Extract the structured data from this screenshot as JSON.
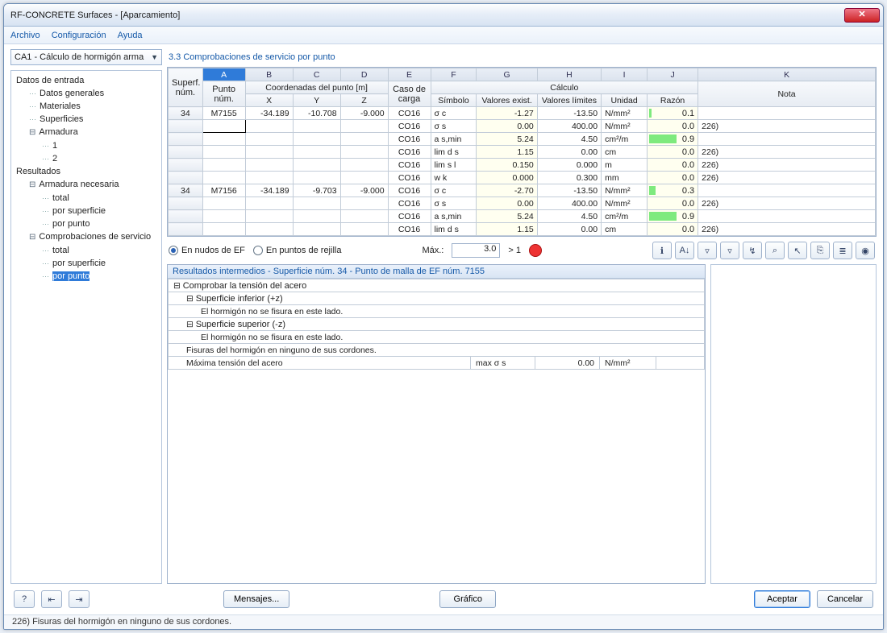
{
  "window": {
    "title": "RF-CONCRETE Surfaces - [Aparcamiento]"
  },
  "menu": {
    "file": "Archivo",
    "config": "Configuración",
    "help": "Ayuda"
  },
  "combo": {
    "value": "CA1 - Cálculo de hormigón arma"
  },
  "tree": {
    "entrada": "Datos de entrada",
    "generales": "Datos generales",
    "materiales": "Materiales",
    "superficies": "Superficies",
    "armadura": "Armadura",
    "a1": "1",
    "a2": "2",
    "resultados": "Resultados",
    "arm_nec": "Armadura necesaria",
    "total": "total",
    "por_superficie": "por superficie",
    "por_punto": "por punto",
    "comprobaciones": "Comprobaciones de servicio",
    "total2": "total",
    "por_superficie2": "por superficie",
    "por_punto2": "por punto"
  },
  "panel": {
    "title": "3.3 Comprobaciones de servicio por punto"
  },
  "headers": {
    "letters": [
      "A",
      "B",
      "C",
      "D",
      "E",
      "F",
      "G",
      "H",
      "I",
      "J",
      "K"
    ],
    "superf": "Superf.\nnúm.",
    "punto": "Punto\nnúm.",
    "coord": "Coordenadas del punto [m]",
    "x": "X",
    "y": "Y",
    "z": "Z",
    "caso": "Caso de\ncarga",
    "calc": "Cálculo",
    "simbolo": "Símbolo",
    "exist": "Valores exist.",
    "lim": "Valores límites",
    "unidad": "Unidad",
    "razon": "Razón",
    "nota": "Nota"
  },
  "rows": [
    {
      "surf": "34",
      "pt": "M7155",
      "x": "-34.189",
      "y": "-10.708",
      "z": "-9.000",
      "c": "CO16",
      "s": "σ c",
      "ve": "-1.27",
      "vl": "-13.50",
      "u": "N/mm²",
      "r": "0.1",
      "rb": 0.05,
      "n": ""
    },
    {
      "surf": "",
      "pt": "",
      "x": "",
      "y": "",
      "z": "",
      "c": "CO16",
      "s": "σ s",
      "ve": "0.00",
      "vl": "400.00",
      "u": "N/mm²",
      "r": "0.0",
      "rb": 0,
      "n": "226)"
    },
    {
      "surf": "",
      "pt": "",
      "x": "",
      "y": "",
      "z": "",
      "c": "CO16",
      "s": "a s,min",
      "ve": "5.24",
      "vl": "4.50",
      "u": "cm²/m",
      "r": "0.9",
      "rb": 0.55,
      "n": ""
    },
    {
      "surf": "",
      "pt": "",
      "x": "",
      "y": "",
      "z": "",
      "c": "CO16",
      "s": "lim d s",
      "ve": "1.15",
      "vl": "0.00",
      "u": "cm",
      "r": "0.0",
      "rb": 0,
      "n": "226)"
    },
    {
      "surf": "",
      "pt": "",
      "x": "",
      "y": "",
      "z": "",
      "c": "CO16",
      "s": "lim s l",
      "ve": "0.150",
      "vl": "0.000",
      "u": "m",
      "r": "0.0",
      "rb": 0,
      "n": "226)"
    },
    {
      "surf": "",
      "pt": "",
      "x": "",
      "y": "",
      "z": "",
      "c": "CO16",
      "s": "w k",
      "ve": "0.000",
      "vl": "0.300",
      "u": "mm",
      "r": "0.0",
      "rb": 0,
      "n": "226)"
    },
    {
      "surf": "34",
      "pt": "M7156",
      "x": "-34.189",
      "y": "-9.703",
      "z": "-9.000",
      "c": "CO16",
      "s": "σ c",
      "ve": "-2.70",
      "vl": "-13.50",
      "u": "N/mm²",
      "r": "0.3",
      "rb": 0.12,
      "n": ""
    },
    {
      "surf": "",
      "pt": "",
      "x": "",
      "y": "",
      "z": "",
      "c": "CO16",
      "s": "σ s",
      "ve": "0.00",
      "vl": "400.00",
      "u": "N/mm²",
      "r": "0.0",
      "rb": 0,
      "n": "226)"
    },
    {
      "surf": "",
      "pt": "",
      "x": "",
      "y": "",
      "z": "",
      "c": "CO16",
      "s": "a s,min",
      "ve": "5.24",
      "vl": "4.50",
      "u": "cm²/m",
      "r": "0.9",
      "rb": 0.55,
      "n": ""
    },
    {
      "surf": "",
      "pt": "",
      "x": "",
      "y": "",
      "z": "",
      "c": "CO16",
      "s": "lim d s",
      "ve": "1.15",
      "vl": "0.00",
      "u": "cm",
      "r": "0.0",
      "rb": 0,
      "n": "226)"
    }
  ],
  "controls": {
    "radio_ef": "En nudos de EF",
    "radio_grid": "En puntos de rejilla",
    "max_label": "Máx.:",
    "max_value": "3.0",
    "gt": "> 1"
  },
  "icons": [
    "ℹ",
    "A↓",
    "▿",
    "▿",
    "↯",
    "⌕",
    "↖",
    "⎘",
    "≣",
    "◉"
  ],
  "intermediate": {
    "title": "Resultados intermedios  -  Superficie núm. 34 - Punto de malla de EF núm. 7155",
    "l1": "Comprobar la tensión del acero",
    "l2": "Superficie inferior (+z)",
    "l3": "El hormigón no se fisura en este lado.",
    "l4": "Superficie superior (-z)",
    "l5": "El hormigón no se fisura en este lado.",
    "l6": "Fisuras del hormigón en ninguno de sus cordones.",
    "l7": "Máxima tensión del acero",
    "sym": "max σ s",
    "val": "0.00",
    "unit": "N/mm²"
  },
  "buttons": {
    "mensajes": "Mensajes...",
    "grafico": "Gráfico",
    "aceptar": "Aceptar",
    "cancelar": "Cancelar"
  },
  "status": "226) Fisuras del hormigón en ninguno de sus cordones."
}
